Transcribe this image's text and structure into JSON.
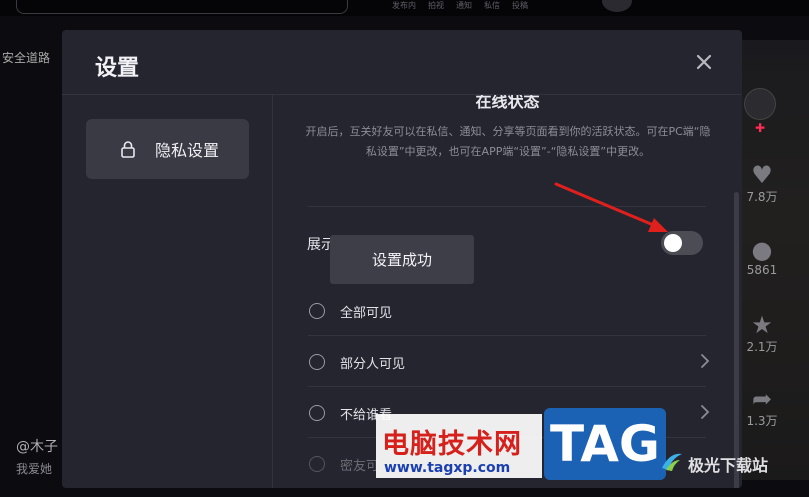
{
  "background": {
    "nav_items": [
      "发布内",
      "拍视",
      "通知",
      "私信",
      "投稿"
    ],
    "left_text": "安全道路",
    "user_handle": "@木子",
    "user_desc": "我爱她",
    "rail": {
      "like_count": "7.8万",
      "comment_count": "5861",
      "fav_count": "2.1万",
      "share_count": "1.3万"
    }
  },
  "modal": {
    "title": "设置",
    "close_icon": "close-icon",
    "sidebar": {
      "items": [
        {
          "label": "隐私设置",
          "icon": "lock-icon"
        }
      ]
    },
    "content": {
      "section_title": "在线状态",
      "description": "开启后，互关好友可以在私信、通知、分享等页面看到你的活跃状态。可在PC端“隐私设置”中更改，也可在APP端“设置”-“隐私设置”中更改。",
      "show_label": "展示",
      "toggle_on": false,
      "toast": "设置成功",
      "options": [
        {
          "label": "全部可见",
          "has_arrow": false,
          "disabled": false
        },
        {
          "label": "部分人可见",
          "has_arrow": true,
          "disabled": false
        },
        {
          "label": "不给谁看",
          "has_arrow": true,
          "disabled": false
        },
        {
          "label": "密友可",
          "has_arrow": false,
          "disabled": true
        }
      ]
    }
  },
  "watermark": {
    "site_name": "电脑技术网",
    "url": "www.tagxp.com",
    "tag": "TAG",
    "secondary": "极光下载站"
  },
  "colors": {
    "modal_bg": "#25252f",
    "toggle_off": "#4c4c55",
    "arrow": "#e0201c"
  }
}
